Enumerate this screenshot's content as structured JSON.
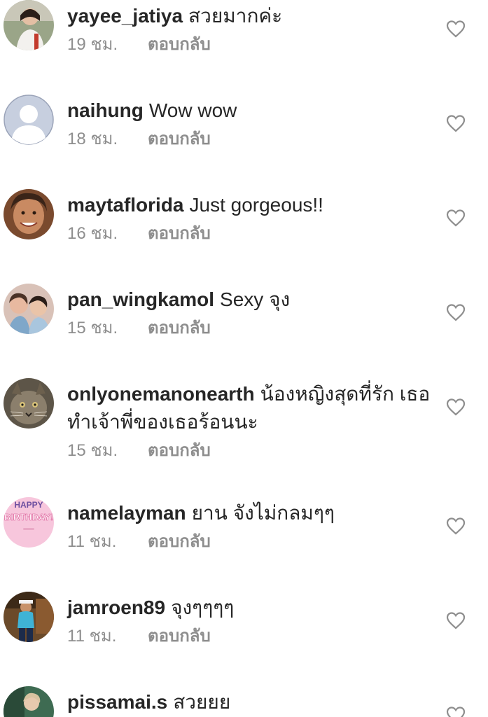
{
  "comments": [
    {
      "username": "yayee_jatiya",
      "text": "สวยมากค่ะ",
      "time": "19 ชม.",
      "reply_label": "ตอบกลับ"
    },
    {
      "username": "naihung",
      "text": "Wow wow",
      "time": "18 ชม.",
      "reply_label": "ตอบกลับ"
    },
    {
      "username": "maytaflorida",
      "text": "Just gorgeous!!",
      "time": "16 ชม.",
      "reply_label": "ตอบกลับ"
    },
    {
      "username": "pan_wingkamol",
      "text": "Sexy จุง",
      "time": "15 ชม.",
      "reply_label": "ตอบกลับ"
    },
    {
      "username": "onlyonemanonearth",
      "text": "น้องหญิงสุดที่รัก เธอทำเจ้าพี่ของเธอร้อนนะ",
      "time": "15 ชม.",
      "reply_label": "ตอบกลับ"
    },
    {
      "username": "namelayman",
      "text": "ยาน จังไม่กลมๆๆ",
      "time": "11 ชม.",
      "reply_label": "ตอบกลับ"
    },
    {
      "username": "jamroen89",
      "text": "จุงๆๆๆๆ",
      "time": "11 ชม.",
      "reply_label": "ตอบกลับ"
    },
    {
      "username": "pissamai.s",
      "text": "สวยยย",
      "time": "",
      "reply_label": ""
    }
  ],
  "avatar_badge_text": {
    "line1": "HAPPY",
    "line2": "BIRTHDAY!"
  },
  "icons": {
    "like": "heart-outline-icon",
    "default_avatar": "default-user-icon"
  },
  "colors": {
    "username": "#262626",
    "meta": "#8e8e8e",
    "heart": "#8e8e8e",
    "default_avatar_bg": "#c7cfdf"
  }
}
